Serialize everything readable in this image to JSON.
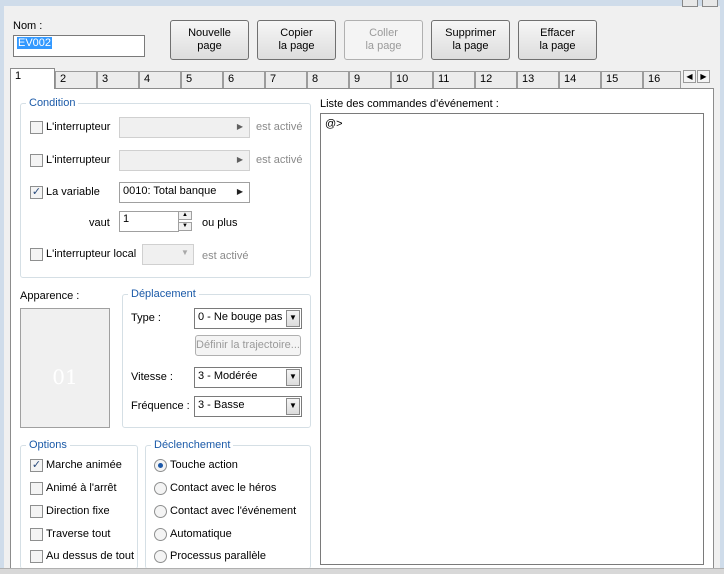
{
  "header": {
    "name_label": "Nom :",
    "name_value": "EV002"
  },
  "toolbar": {
    "new_page": [
      "Nouvelle",
      "page"
    ],
    "copy_page": [
      "Copier",
      "la page"
    ],
    "paste_page": [
      "Coller",
      "la page"
    ],
    "delete_page": [
      "Supprimer",
      "la page"
    ],
    "clear_page": [
      "Effacer",
      "la page"
    ]
  },
  "tabs": [
    "1",
    "2",
    "3",
    "4",
    "5",
    "6",
    "7",
    "8",
    "9",
    "10",
    "11",
    "12",
    "13",
    "14",
    "15",
    "16"
  ],
  "active_tab": "1",
  "condition": {
    "title": "Condition",
    "switch1": {
      "label": "L'interrupteur",
      "suffix": "est activé",
      "checked": false
    },
    "switch2": {
      "label": "L'interrupteur",
      "suffix": "est activé",
      "checked": false
    },
    "variable": {
      "label": "La variable",
      "value": "0010: Total banque",
      "checked": true
    },
    "vaut_label": "vaut",
    "vaut_value": "1",
    "ou_plus": "ou plus",
    "local_switch": {
      "label": "L'interrupteur local",
      "suffix": "est activé",
      "checked": false
    }
  },
  "appearance": {
    "label": "Apparence :",
    "preview_text": "01"
  },
  "movement": {
    "title": "Déplacement",
    "type_label": "Type :",
    "type_value": "0 - Ne bouge pas",
    "route_button": "Définir la trajectoire...",
    "speed_label": "Vitesse :",
    "speed_value": "3 - Modérée",
    "freq_label": "Fréquence :",
    "freq_value": "3 - Basse"
  },
  "options": {
    "title": "Options",
    "items": [
      {
        "label": "Marche animée",
        "checked": true
      },
      {
        "label": "Animé à l'arrêt",
        "checked": false
      },
      {
        "label": "Direction fixe",
        "checked": false
      },
      {
        "label": "Traverse tout",
        "checked": false
      },
      {
        "label": "Au dessus de tout",
        "checked": false
      }
    ]
  },
  "trigger": {
    "title": "Déclenchement",
    "items": [
      {
        "label": "Touche action",
        "selected": true
      },
      {
        "label": "Contact avec le héros",
        "selected": false
      },
      {
        "label": "Contact avec l'événement",
        "selected": false
      },
      {
        "label": "Automatique",
        "selected": false
      },
      {
        "label": "Processus parallèle",
        "selected": false
      }
    ]
  },
  "commands": {
    "label": "Liste des commandes d'événement :",
    "items": [
      "@>"
    ]
  }
}
